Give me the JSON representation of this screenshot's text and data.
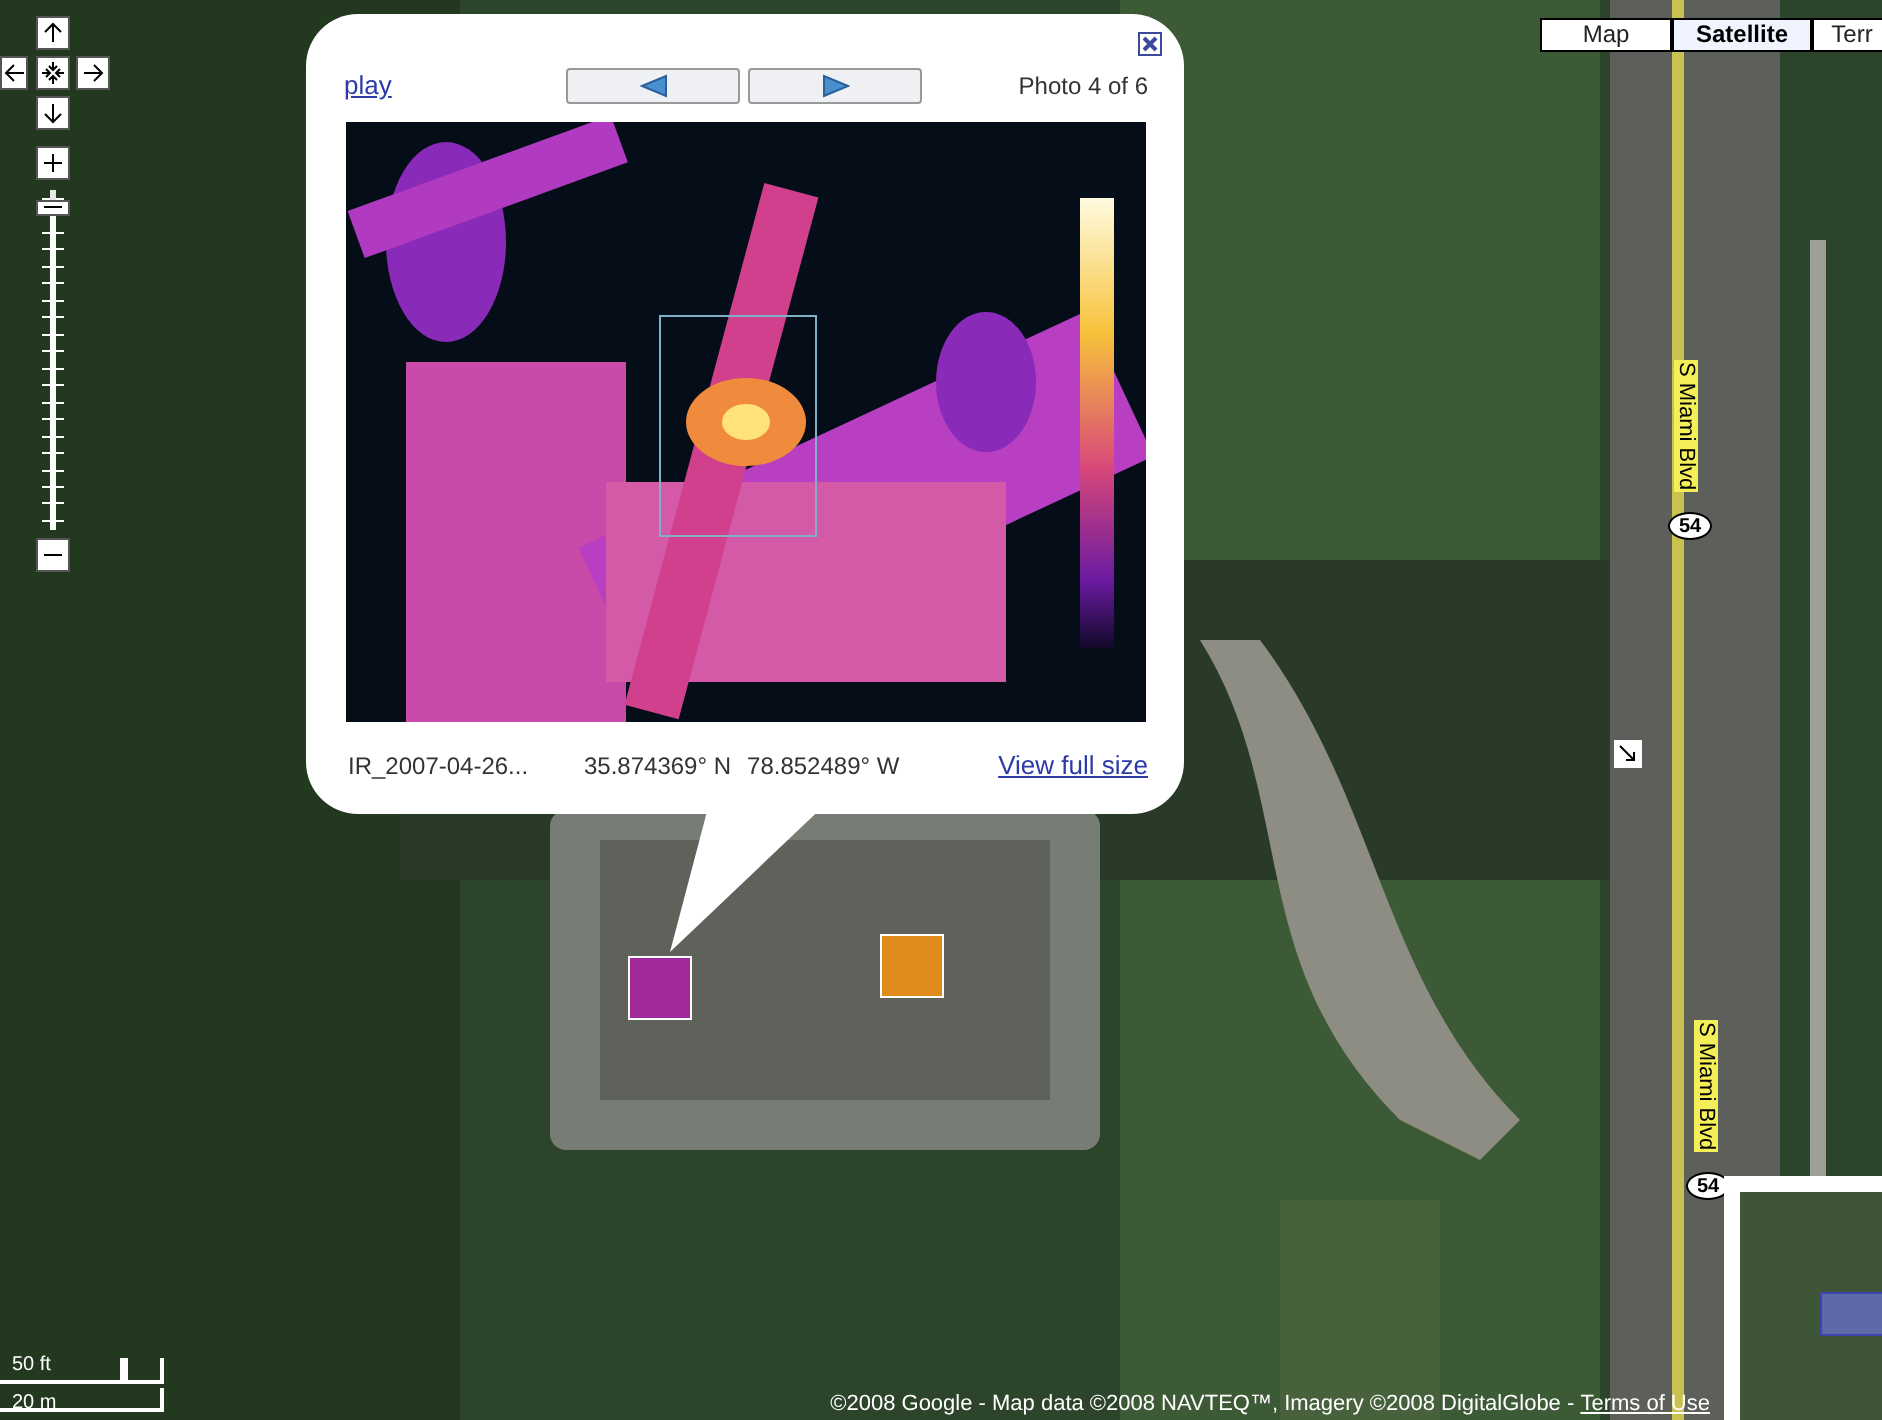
{
  "map_types": [
    {
      "label": "Map",
      "selected": false
    },
    {
      "label": "Satellite",
      "selected": true
    },
    {
      "label": "Terr",
      "selected": false
    }
  ],
  "zoom_slider": {
    "level": 0.95
  },
  "info_window": {
    "play_link": "play",
    "photo_counter": "Photo 4 of 6",
    "filename": "IR_2007-04-26...",
    "latitude": "35.874369° N",
    "longitude": "78.852489° W",
    "full_size_link": "View full size"
  },
  "road_labels": [
    {
      "text": "S Miami Blvd"
    },
    {
      "text": "S Miami Blvd"
    }
  ],
  "route_shields": [
    {
      "text": "54"
    },
    {
      "text": "54"
    }
  ],
  "scale": {
    "imperial": "50 ft",
    "metric": "20 m"
  },
  "copyright": {
    "text": "©2008 Google - Map data ©2008 NAVTEQ™, Imagery ©2008 DigitalGlobe - ",
    "terms_link": "Terms of Use"
  }
}
